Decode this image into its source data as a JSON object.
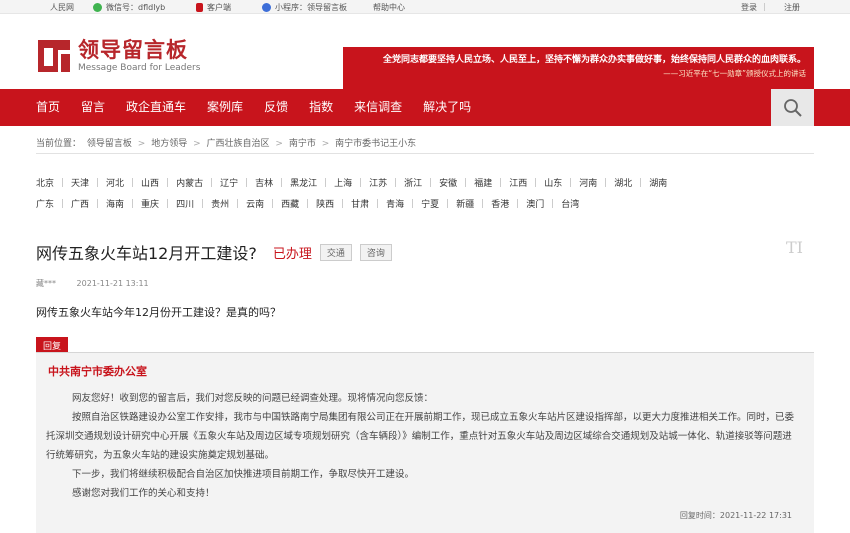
{
  "topbar": {
    "renmin": "人民网",
    "wechat": "微信号：dfldlyb",
    "client": "客户端",
    "miniapp": "小程序：领导留言板",
    "help": "帮助中心",
    "login": "登录",
    "register": "注册"
  },
  "logo": {
    "title": "领导留言板",
    "subtitle": "Message Board for Leaders"
  },
  "banner": {
    "quote": "全党同志都要坚持人民立场、人民至上，坚持不懈为群众办实事做好事，始终保持同人民群众的血肉联系。",
    "source": "——习近平在“七一勋章”颁授仪式上的讲话"
  },
  "nav": {
    "items": [
      "首页",
      "留言",
      "政企直通车",
      "案例库",
      "反馈",
      "指数",
      "来信调查",
      "解决了吗"
    ]
  },
  "breadcrumb": {
    "label": "当前位置：",
    "items": [
      "领导留言板",
      "地方领导",
      "广西壮族自治区",
      "南宁市",
      "南宁市委书记王小东"
    ],
    "sep": ">"
  },
  "regions": {
    "row1": [
      "北京",
      "天津",
      "河北",
      "山西",
      "内蒙古",
      "辽宁",
      "吉林",
      "黑龙江",
      "上海",
      "江苏",
      "浙江",
      "安徽",
      "福建",
      "江西",
      "山东",
      "河南",
      "湖北",
      "湖南"
    ],
    "row2": [
      "广东",
      "广西",
      "海南",
      "重庆",
      "四川",
      "贵州",
      "云南",
      "西藏",
      "陕西",
      "甘肃",
      "青海",
      "宁夏",
      "新疆",
      "香港",
      "澳门",
      "台湾"
    ]
  },
  "post": {
    "title": "网传五象火车站12月开工建设?",
    "status": "已办理",
    "tag1": "交通",
    "tag2": "咨询",
    "watermark": "TI",
    "author": "藏***",
    "time": "2021-11-21 13:11",
    "question": "网传五象火车站今年12月份开工建设？是真的吗？"
  },
  "reply": {
    "tag": "回复",
    "org": "中共南宁市委办公室",
    "p1": "网友您好！收到您的留言后，我们对您反映的问题已经调查处理。现将情况向您反馈：",
    "p2": "按照自治区铁路建设办公室工作安排，我市与中国铁路南宁局集团有限公司正在开展前期工作，现已成立五象火车站片区建设指挥部，以更大力度推进相关工作。同时，已委托深圳交通规划设计研究中心开展《五象火车站及周边区域专项规划研究（含车辆段）》编制工作，重点针对五象火车站及周边区域综合交通规划及站城一体化、轨道接驳等问题进行统筹研究，为五象火车站的建设实施奠定规划基础。",
    "p3": "下一步，我们将继续积极配合自治区加快推进项目前期工作，争取尽快开工建设。",
    "p4": "感谢您对我们工作的关心和支持！",
    "time": "回复时间：2021-11-22 17:31"
  },
  "colors": {
    "brand_red": "#c8141c",
    "bg_reply": "#f3f3f3"
  }
}
